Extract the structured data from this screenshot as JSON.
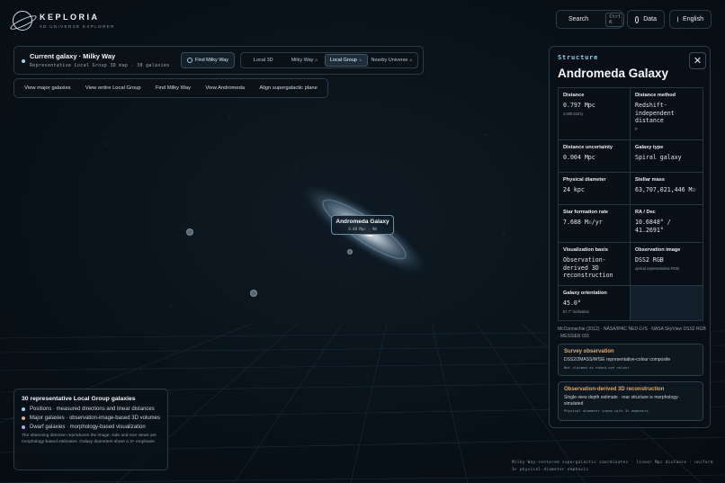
{
  "brand": {
    "name": "KEPLORIA",
    "subtitle": "3D UNIVERSE EXPLORER"
  },
  "topbar": {
    "search_label": "Search",
    "search_shortcut": "Ctrl K",
    "data_label": "Data",
    "language_label": "English"
  },
  "galaxy_panel": {
    "current_label": "Current galaxy · Milky Way",
    "description": "Representative Local Group 3D map · 30 galaxies",
    "find_button": "Find Milky Way",
    "scale_tabs": [
      {
        "label": "Local 3D",
        "marker": ""
      },
      {
        "label": "Milky Way",
        "marker": "a"
      },
      {
        "label": "Local Group",
        "marker": "↳"
      },
      {
        "label": "Nearby Universe",
        "marker": "a"
      }
    ],
    "active_tab": "Local Group"
  },
  "actions": [
    "View major galaxies",
    "View entire Local Group",
    "Find Milky Way",
    "View Andromeda",
    "Align supergalactic plane"
  ],
  "viewport": {
    "selected_label": "Andromeda Galaxy",
    "selected_sub": "0.80 Mpc · 9W"
  },
  "legend": {
    "title": "30 representative Local Group galaxies",
    "rows": [
      {
        "text": "Positions · measured directions and linear distances",
        "color": "#9fd7ee"
      },
      {
        "text": "Major galaxies · observation-image-based 3D volumes",
        "color": "#e4a86b"
      },
      {
        "text": "Dwarf galaxies · morphology-based visualization",
        "color": "#b7a7e6"
      }
    ],
    "note": "The observing direction reproduces the image; side and rear views are morphology-based estimates. Galaxy diameters share a 3× emphasis."
  },
  "caption": "Milky Way-centered supergalactic coordinates · linear Mpc distance · uniform 3× physical-diameter emphasis",
  "structure": {
    "kicker": "Structure",
    "name": "Andromeda Galaxy",
    "cells": [
      {
        "label": "Distance",
        "value": "0.797 Mpc",
        "small": "2,600,618 ly"
      },
      {
        "label": "Distance method",
        "value": "Redshift-independent distance",
        "small": "P"
      },
      {
        "label": "Distance uncertainty",
        "value": "0.004 Mpc",
        "small": ""
      },
      {
        "label": "Galaxy type",
        "value": "Spiral galaxy",
        "small": ""
      },
      {
        "label": "Physical diameter",
        "value": "24 kpc",
        "small": ""
      },
      {
        "label": "Stellar mass",
        "value": "63,707,021,446 M☉",
        "small": ""
      },
      {
        "label": "Star formation rate",
        "value": "7.688 M☉/yr",
        "small": ""
      },
      {
        "label": "RA / Dec",
        "value": "10.6848° / 41.2691°",
        "small": ""
      },
      {
        "label": "Visualization basis",
        "value": "Observation-derived 3D reconstruction",
        "small": ""
      },
      {
        "label": "Observation image",
        "value": "DSS2 RGB",
        "small": "optical representative RGB"
      },
      {
        "label": "Galaxy orientation",
        "value": "45.0°",
        "small": "57.7° inclination"
      }
    ],
    "sources": "McConnachie (2012) · NASA/IPAC NED-LVS · NASA SkyView DSS2 RGB · MESSIER 031",
    "cards": [
      {
        "title": "Survey observation",
        "desc": "DSS2/2MASS/WISE representative-colour composite",
        "meta": "Not claimed as naked-eye colour"
      },
      {
        "title": "Observation-derived 3D reconstruction",
        "desc": "Single-view depth estimate · rear structure is morphology-simulated",
        "meta": "Physical diameter shown with 3× emphasis"
      }
    ]
  },
  "colors": {
    "accent": "#8fd0ea",
    "warm": "#e4a86b",
    "panel_border": "#2b3944",
    "background": "#091219"
  }
}
